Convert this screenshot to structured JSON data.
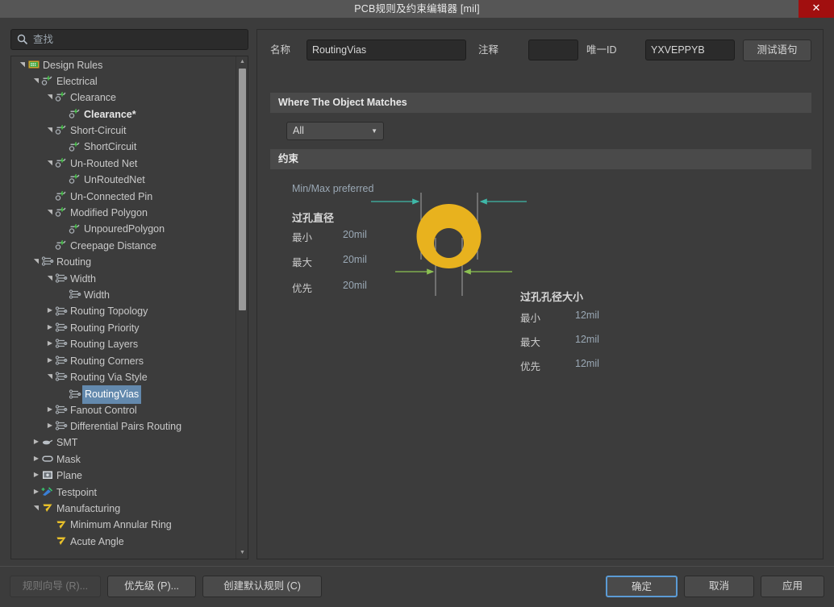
{
  "window": {
    "title": "PCB规则及约束编辑器 [mil]",
    "close_label": "✕"
  },
  "search": {
    "placeholder": "查找",
    "icon": "search-icon"
  },
  "tree": {
    "items": [
      {
        "label": "Design Rules",
        "depth": 0,
        "twisty": "open",
        "icon": "design-rules",
        "bold": false,
        "selected": false
      },
      {
        "label": "Electrical",
        "depth": 1,
        "twisty": "open",
        "icon": "electrical",
        "bold": false,
        "selected": false
      },
      {
        "label": "Clearance",
        "depth": 2,
        "twisty": "open",
        "icon": "electrical",
        "bold": false,
        "selected": false
      },
      {
        "label": "Clearance*",
        "depth": 3,
        "twisty": "none",
        "icon": "electrical",
        "bold": true,
        "selected": false
      },
      {
        "label": "Short-Circuit",
        "depth": 2,
        "twisty": "open",
        "icon": "electrical",
        "bold": false,
        "selected": false
      },
      {
        "label": "ShortCircuit",
        "depth": 3,
        "twisty": "none",
        "icon": "electrical",
        "bold": false,
        "selected": false
      },
      {
        "label": "Un-Routed Net",
        "depth": 2,
        "twisty": "open",
        "icon": "electrical",
        "bold": false,
        "selected": false
      },
      {
        "label": "UnRoutedNet",
        "depth": 3,
        "twisty": "none",
        "icon": "electrical",
        "bold": false,
        "selected": false
      },
      {
        "label": "Un-Connected Pin",
        "depth": 2,
        "twisty": "none",
        "icon": "electrical",
        "bold": false,
        "selected": false
      },
      {
        "label": "Modified Polygon",
        "depth": 2,
        "twisty": "open",
        "icon": "electrical",
        "bold": false,
        "selected": false
      },
      {
        "label": "UnpouredPolygon",
        "depth": 3,
        "twisty": "none",
        "icon": "electrical",
        "bold": false,
        "selected": false
      },
      {
        "label": "Creepage Distance",
        "depth": 2,
        "twisty": "none",
        "icon": "electrical",
        "bold": false,
        "selected": false
      },
      {
        "label": "Routing",
        "depth": 1,
        "twisty": "open",
        "icon": "routing",
        "bold": false,
        "selected": false
      },
      {
        "label": "Width",
        "depth": 2,
        "twisty": "open",
        "icon": "routing",
        "bold": false,
        "selected": false
      },
      {
        "label": "Width",
        "depth": 3,
        "twisty": "none",
        "icon": "routing",
        "bold": false,
        "selected": false
      },
      {
        "label": "Routing Topology",
        "depth": 2,
        "twisty": "closed",
        "icon": "routing",
        "bold": false,
        "selected": false
      },
      {
        "label": "Routing Priority",
        "depth": 2,
        "twisty": "closed",
        "icon": "routing",
        "bold": false,
        "selected": false
      },
      {
        "label": "Routing Layers",
        "depth": 2,
        "twisty": "closed",
        "icon": "routing",
        "bold": false,
        "selected": false
      },
      {
        "label": "Routing Corners",
        "depth": 2,
        "twisty": "closed",
        "icon": "routing",
        "bold": false,
        "selected": false
      },
      {
        "label": "Routing Via Style",
        "depth": 2,
        "twisty": "open",
        "icon": "routing",
        "bold": false,
        "selected": false
      },
      {
        "label": "RoutingVias",
        "depth": 3,
        "twisty": "none",
        "icon": "routing",
        "bold": false,
        "selected": true
      },
      {
        "label": "Fanout Control",
        "depth": 2,
        "twisty": "closed",
        "icon": "routing",
        "bold": false,
        "selected": false
      },
      {
        "label": "Differential Pairs Routing",
        "depth": 2,
        "twisty": "closed",
        "icon": "routing",
        "bold": false,
        "selected": false
      },
      {
        "label": "SMT",
        "depth": 1,
        "twisty": "closed",
        "icon": "smt",
        "bold": false,
        "selected": false
      },
      {
        "label": "Mask",
        "depth": 1,
        "twisty": "closed",
        "icon": "mask",
        "bold": false,
        "selected": false
      },
      {
        "label": "Plane",
        "depth": 1,
        "twisty": "closed",
        "icon": "plane",
        "bold": false,
        "selected": false
      },
      {
        "label": "Testpoint",
        "depth": 1,
        "twisty": "closed",
        "icon": "testpoint",
        "bold": false,
        "selected": false
      },
      {
        "label": "Manufacturing",
        "depth": 1,
        "twisty": "open",
        "icon": "manufacturing",
        "bold": false,
        "selected": false
      },
      {
        "label": "Minimum Annular Ring",
        "depth": 2,
        "twisty": "none",
        "icon": "manufacturing",
        "bold": false,
        "selected": false
      },
      {
        "label": "Acute Angle",
        "depth": 2,
        "twisty": "none",
        "icon": "manufacturing",
        "bold": false,
        "selected": false
      }
    ]
  },
  "form": {
    "name_label": "名称",
    "name_value": "RoutingVias",
    "comment_label": "注释",
    "comment_value": "",
    "uid_label": "唯一ID",
    "uid_value": "YXVEPPYB",
    "test_button": "测试语句"
  },
  "where_section": {
    "header": "Where The Object Matches",
    "scope_value": "All"
  },
  "constraint_section": {
    "header": "约束",
    "minmax_label": "Min/Max preferred",
    "via_diameter": {
      "title": "过孔直径",
      "rows": [
        {
          "label": "最小",
          "value": "20mil"
        },
        {
          "label": "最大",
          "value": "20mil"
        },
        {
          "label": "优先",
          "value": "20mil"
        }
      ]
    },
    "via_hole_size": {
      "title": "过孔孔径大小",
      "rows": [
        {
          "label": "最小",
          "value": "12mil"
        },
        {
          "label": "最大",
          "value": "12mil"
        },
        {
          "label": "优先",
          "value": "12mil"
        }
      ]
    },
    "colors": {
      "via_pad": "#e8b21e",
      "diameter_arrow": "#3fb8a8",
      "hole_arrow": "#8cc152"
    }
  },
  "footer": {
    "rule_wizard": "规则向导 (R)...",
    "priority": "优先级 (P)...",
    "create_default": "创建默认规则 (C)",
    "ok": "确定",
    "cancel": "取消",
    "apply": "应用"
  }
}
